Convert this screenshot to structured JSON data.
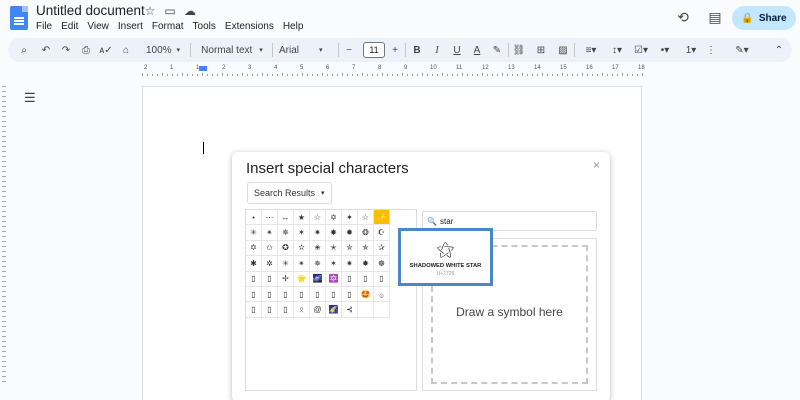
{
  "app": {
    "title": "Untitled document",
    "menu": [
      "File",
      "Edit",
      "View",
      "Insert",
      "Format",
      "Tools",
      "Extensions",
      "Help"
    ],
    "share_label": "Share"
  },
  "toolbar": {
    "zoom": "100%",
    "style": "Normal text",
    "font": "Arial",
    "font_size": "11",
    "text_color_letter": "A",
    "bold": "B",
    "italic": "I",
    "underline": "U"
  },
  "ruler": {
    "numbers": [
      "2",
      "1",
      "1",
      "2",
      "3",
      "4",
      "5",
      "6",
      "7",
      "8",
      "9",
      "10",
      "11",
      "12",
      "13",
      "14",
      "15",
      "16",
      "17",
      "18"
    ]
  },
  "dialog": {
    "title": "Insert special characters",
    "close": "×",
    "category": "Search Results",
    "search_value": "star",
    "draw_placeholder": "Draw a symbol here",
    "grid_symbols": [
      "⋆",
      "⋯",
      "↔",
      "★",
      "☆",
      "✡",
      "✦",
      "☆",
      "✨",
      "✳",
      "✴",
      "✵",
      "✶",
      "✷",
      "✸",
      "✹",
      "❂",
      "☪",
      "✡",
      "✩",
      "✪",
      "✫",
      "✬",
      "✭",
      "✮",
      "✯",
      "✰",
      "✱",
      "✲",
      "✳",
      "✴",
      "✵",
      "✶",
      "✷",
      "✸",
      "☸",
      "▯",
      "▯",
      "✢",
      "🌟",
      "🌌",
      "🔯",
      "▯",
      "▯",
      "▯",
      "▯",
      "▯",
      "▯",
      "▯",
      "▯",
      "▯",
      "▯",
      "🤩",
      "۞",
      "▯",
      "▯",
      "▯",
      "ᛟ",
      "@",
      "🌠",
      "⊰",
      "",
      ""
    ],
    "selected_index": 8
  },
  "preview": {
    "glyph": "⚝",
    "name": "SHADOWED WHITE STAR",
    "code": "U+2729"
  }
}
